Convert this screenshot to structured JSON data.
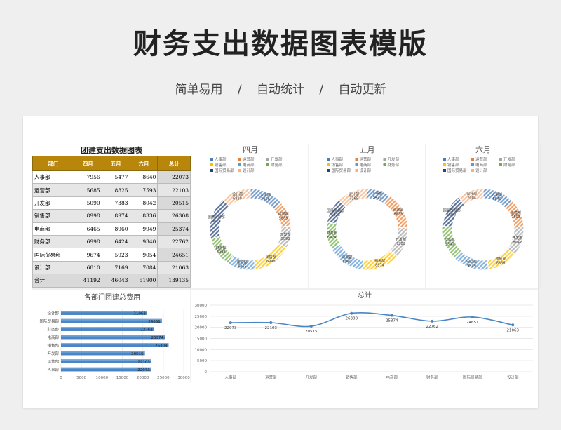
{
  "header": {
    "title": "财务支出数据图表模版",
    "subtitle_items": [
      "简单易用",
      "自动统计",
      "自动更新"
    ],
    "separator": "/"
  },
  "table": {
    "title": "团建支出数据图表",
    "columns": [
      "部门",
      "四月",
      "五月",
      "六月",
      "总计"
    ],
    "rows": [
      [
        "人事部",
        "7956",
        "5477",
        "8640",
        "22073"
      ],
      [
        "运营部",
        "5685",
        "8825",
        "7593",
        "22103"
      ],
      [
        "开发部",
        "5090",
        "7383",
        "8042",
        "20515"
      ],
      [
        "销售部",
        "8998",
        "8974",
        "8336",
        "26308"
      ],
      [
        "电商部",
        "6465",
        "8960",
        "9949",
        "25374"
      ],
      [
        "财务部",
        "6998",
        "6424",
        "9340",
        "22762"
      ],
      [
        "国际贸易部",
        "9674",
        "5923",
        "9054",
        "24651"
      ],
      [
        "设计部",
        "6810",
        "7169",
        "7084",
        "21063"
      ]
    ],
    "total_row": [
      "合计",
      "41192",
      "46043",
      "51900",
      "139135"
    ]
  },
  "colors": {
    "gold": "#b8860b",
    "departments": [
      "#4a7ebb",
      "#ed7d31",
      "#a5a5a5",
      "#ffc000",
      "#5b9bd5",
      "#70ad47",
      "#264478",
      "#f4b183"
    ]
  },
  "chart_data": [
    {
      "type": "pie",
      "title": "四月",
      "legend": "top",
      "labels": [
        "人事部",
        "运营部",
        "开发部",
        "销售部",
        "电商部",
        "财务部",
        "国际贸易部",
        "设计部"
      ],
      "values": [
        7956,
        5685,
        5090,
        8998,
        6465,
        6998,
        9674,
        6810
      ]
    },
    {
      "type": "pie",
      "title": "五月",
      "legend": "top",
      "labels": [
        "人事部",
        "运营部",
        "开发部",
        "销售部",
        "电商部",
        "财务部",
        "国际贸易部",
        "设计部"
      ],
      "values": [
        5477,
        8825,
        7383,
        8974,
        8960,
        6424,
        5923,
        7169
      ]
    },
    {
      "type": "pie",
      "title": "六月",
      "legend": "top",
      "labels": [
        "人事部",
        "运营部",
        "开发部",
        "销售部",
        "电商部",
        "财务部",
        "国际贸易部",
        "设计部"
      ],
      "values": [
        8640,
        7593,
        8042,
        8336,
        9949,
        9340,
        9054,
        7084
      ]
    },
    {
      "type": "bar",
      "title": "各部门团建总费用",
      "orientation": "horizontal",
      "categories": [
        "人事部",
        "运营部",
        "开发部",
        "销售部",
        "电商部",
        "财务部",
        "国际贸易部",
        "设计部"
      ],
      "values": [
        22073,
        22103,
        20515,
        26308,
        25374,
        22762,
        24651,
        21063
      ],
      "xlim": [
        0,
        30000
      ],
      "xticks": [
        "0",
        "5000",
        "10000",
        "15000",
        "20000",
        "25000",
        "30000"
      ]
    },
    {
      "type": "line",
      "title": "总计",
      "categories": [
        "人事部",
        "运营部",
        "开发部",
        "销售部",
        "电商部",
        "财务部",
        "国际贸易部",
        "设计部"
      ],
      "values": [
        22073,
        22103,
        20515,
        26308,
        25374,
        22762,
        24651,
        21063
      ],
      "ylim": [
        0,
        30000
      ],
      "yticks": [
        "0",
        "5000",
        "10000",
        "15000",
        "20000",
        "25000",
        "30000"
      ],
      "grid": true
    }
  ]
}
